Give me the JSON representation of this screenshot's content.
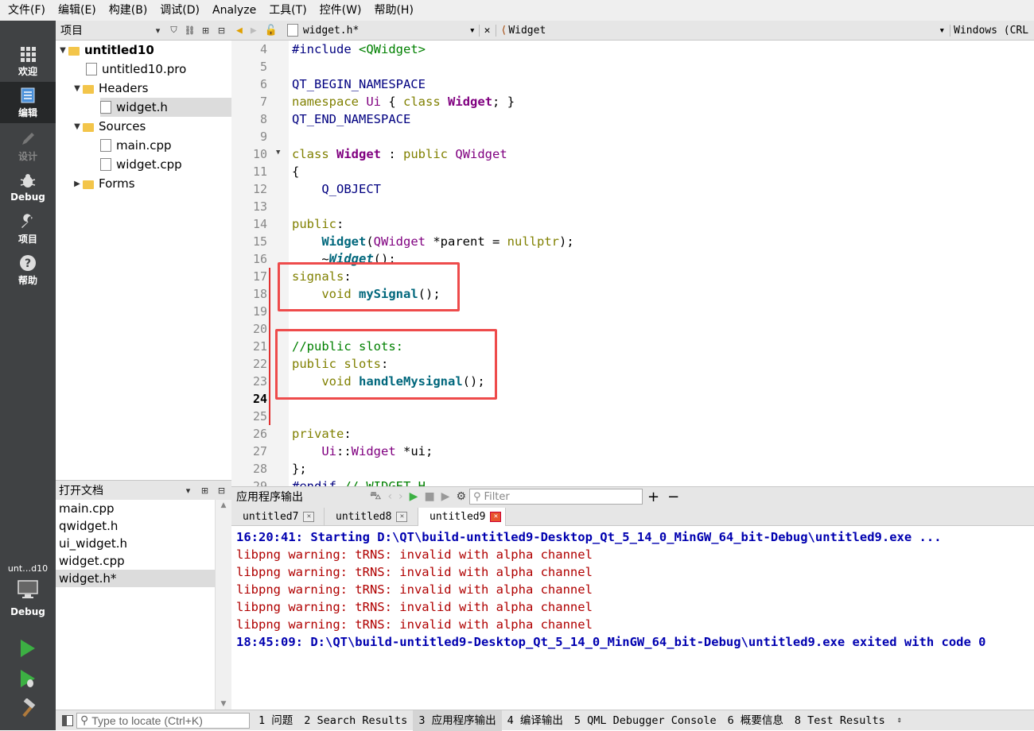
{
  "menu": [
    "文件(F)",
    "编辑(E)",
    "构建(B)",
    "调试(D)",
    "Analyze",
    "工具(T)",
    "控件(W)",
    "帮助(H)"
  ],
  "modes": [
    {
      "label": "欢迎",
      "icon": "grid-icon"
    },
    {
      "label": "编辑",
      "icon": "document-icon"
    },
    {
      "label": "设计",
      "icon": "pencil-icon"
    },
    {
      "label": "Debug",
      "icon": "bug-icon"
    },
    {
      "label": "项目",
      "icon": "wrench-icon"
    },
    {
      "label": "帮助",
      "icon": "help-icon"
    }
  ],
  "project_panel": {
    "title": "项目",
    "tree": [
      {
        "label": "untitled10",
        "level": 0,
        "expanded": true,
        "kind": "project"
      },
      {
        "label": "untitled10.pro",
        "level": 1,
        "kind": "pro"
      },
      {
        "label": "Headers",
        "level": 1,
        "expanded": true,
        "kind": "folder"
      },
      {
        "label": "widget.h",
        "level": 2,
        "kind": "file",
        "selected": true
      },
      {
        "label": "Sources",
        "level": 1,
        "expanded": true,
        "kind": "folder"
      },
      {
        "label": "main.cpp",
        "level": 2,
        "kind": "file"
      },
      {
        "label": "widget.cpp",
        "level": 2,
        "kind": "file"
      },
      {
        "label": "Forms",
        "level": 1,
        "expanded": false,
        "kind": "folder"
      }
    ]
  },
  "open_docs": {
    "title": "打开文档",
    "items": [
      "main.cpp",
      "qwidget.h",
      "ui_widget.h",
      "widget.cpp",
      "widget.h*"
    ],
    "selected": "widget.h*"
  },
  "editor_toolbar": {
    "file": "widget.h*",
    "symbol": "Widget",
    "encoding": "Windows (CRL"
  },
  "editor": {
    "current_line": 24,
    "lines": [
      {
        "n": "4",
        "code": "#include <QWidget>"
      },
      {
        "n": "5",
        "code": ""
      },
      {
        "n": "6",
        "code": "QT_BEGIN_NAMESPACE"
      },
      {
        "n": "7",
        "code": "namespace Ui { class Widget; }"
      },
      {
        "n": "8",
        "code": "QT_END_NAMESPACE"
      },
      {
        "n": "9",
        "code": ""
      },
      {
        "n": "10",
        "code": "class Widget : public QWidget"
      },
      {
        "n": "11",
        "code": "{"
      },
      {
        "n": "12",
        "code": "    Q_OBJECT"
      },
      {
        "n": "13",
        "code": ""
      },
      {
        "n": "14",
        "code": "public:"
      },
      {
        "n": "15",
        "code": "    Widget(QWidget *parent = nullptr);"
      },
      {
        "n": "16",
        "code": "    ~Widget();"
      },
      {
        "n": "17",
        "code": "signals:"
      },
      {
        "n": "18",
        "code": "    void mySignal();"
      },
      {
        "n": "19",
        "code": ""
      },
      {
        "n": "20",
        "code": ""
      },
      {
        "n": "21",
        "code": "//public slots:"
      },
      {
        "n": "22",
        "code": "public slots:"
      },
      {
        "n": "23",
        "code": "    void handleMysignal();"
      },
      {
        "n": "24",
        "code": ""
      },
      {
        "n": "25",
        "code": ""
      },
      {
        "n": "26",
        "code": "private:"
      },
      {
        "n": "27",
        "code": "    Ui::Widget *ui;"
      },
      {
        "n": "28",
        "code": "};"
      },
      {
        "n": "29",
        "code": "#endif // WIDGET_H"
      }
    ]
  },
  "output_pane": {
    "title": "应用程序输出",
    "filter_placeholder": "Filter",
    "tabs": [
      "untitled7",
      "untitled8",
      "untitled9"
    ],
    "active_tab": "untitled9",
    "lines": [
      {
        "text": "16:20:41: Starting D:\\QT\\build-untitled9-Desktop_Qt_5_14_0_MinGW_64_bit-Debug\\untitled9.exe ...",
        "style": "blue"
      },
      {
        "text": "libpng warning: tRNS: invalid with alpha channel",
        "style": "red"
      },
      {
        "text": "libpng warning: tRNS: invalid with alpha channel",
        "style": "red"
      },
      {
        "text": "libpng warning: tRNS: invalid with alpha channel",
        "style": "red"
      },
      {
        "text": "libpng warning: tRNS: invalid with alpha channel",
        "style": "red"
      },
      {
        "text": "libpng warning: tRNS: invalid with alpha channel",
        "style": "red"
      },
      {
        "text": "18:45:09: D:\\QT\\build-untitled9-Desktop_Qt_5_14_0_MinGW_64_bit-Debug\\untitled9.exe exited with code 0",
        "style": "blue"
      }
    ]
  },
  "kit_selector": {
    "name": "unt…d10",
    "mode": "Debug"
  },
  "status_bar": {
    "locator_placeholder": "Type to locate (Ctrl+K)",
    "items": [
      "1 问题",
      "2 Search Results",
      "3 应用程序输出",
      "4 编译输出",
      "5 QML Debugger Console",
      "6 概要信息",
      "8 Test Results"
    ],
    "active": "3 应用程序输出"
  },
  "colors": {
    "mode_bar": "#404244",
    "highlight_box": "#ee4b4b",
    "keyword": "#808000",
    "type": "#800080",
    "output_blue": "#0000b0",
    "output_red": "#b00000"
  }
}
